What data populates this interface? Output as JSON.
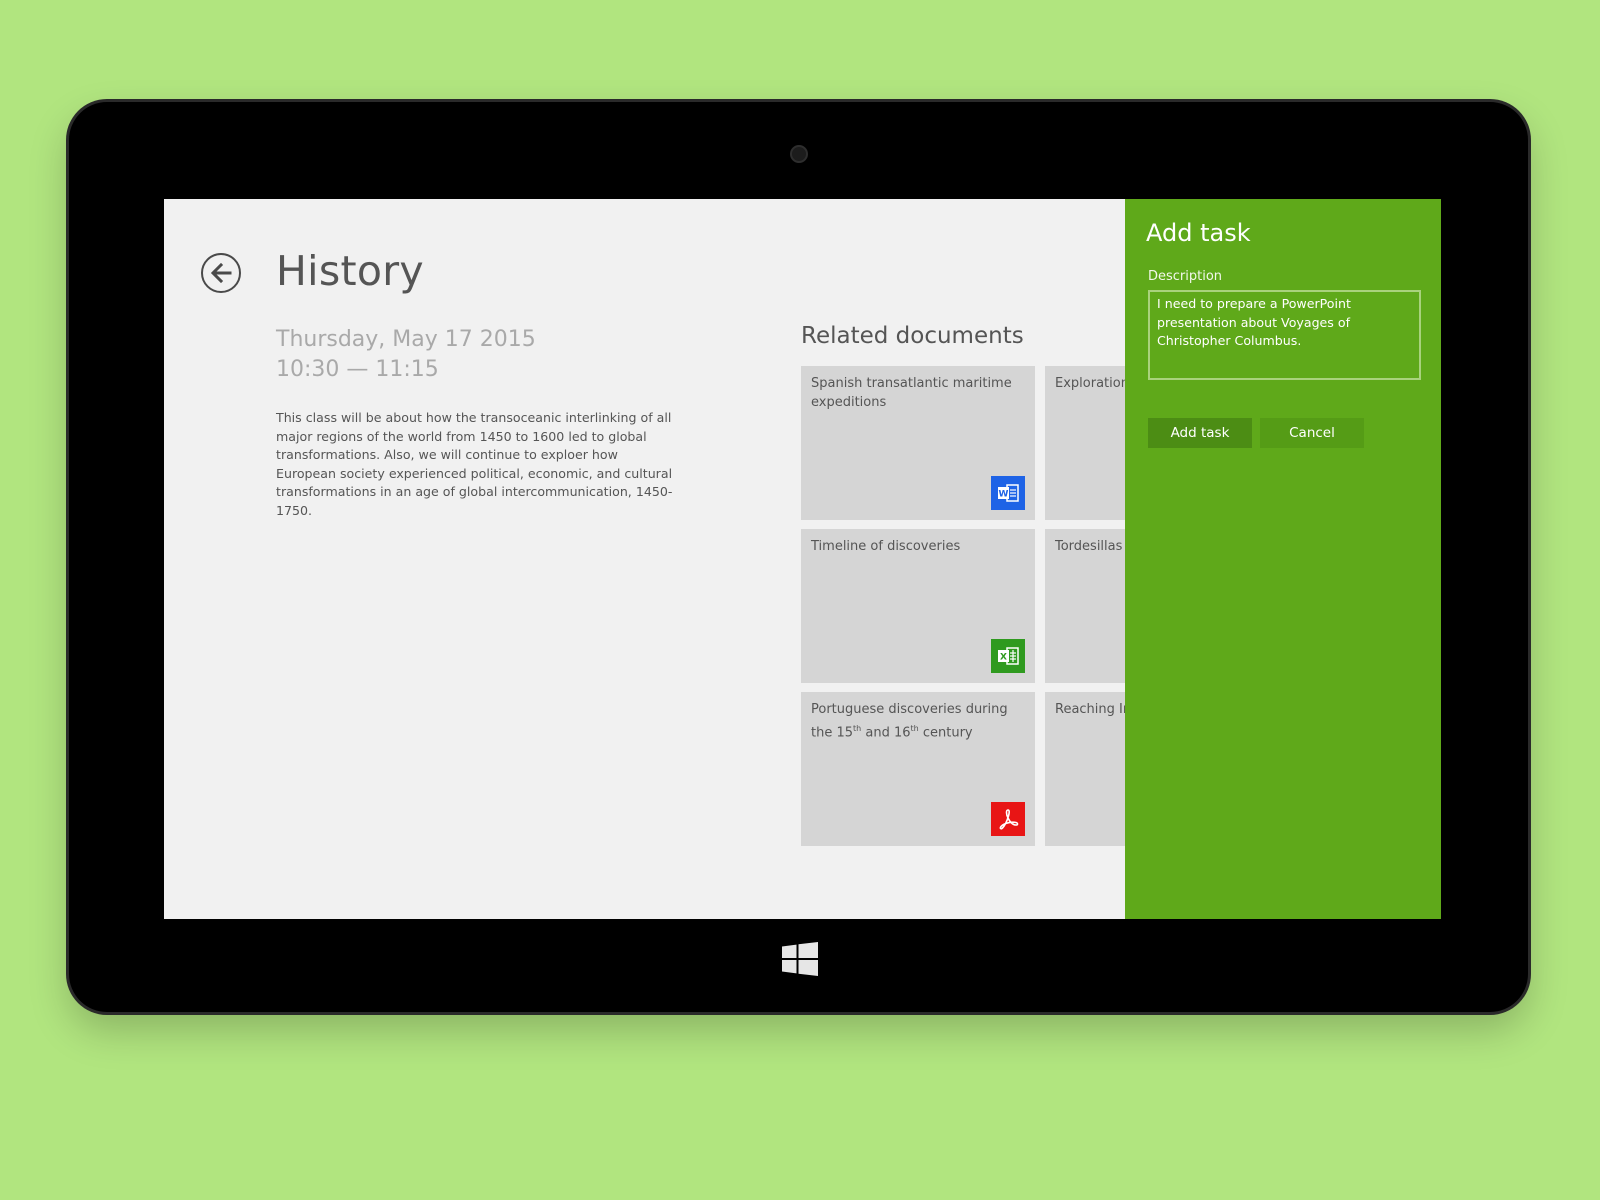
{
  "page": {
    "title": "History",
    "date": "Thursday, May 17 2015",
    "time": "10:30 — 11:15",
    "description": "This class will be about how the transoceanic interlinking of all major regions of the world from 1450 to 1600 led to global transformations. Also, we will continue to exploer how European society experienced political, economic, and cultural transformations in an age of global intercommunication, 1450-1750."
  },
  "related": {
    "title": "Related documents",
    "documents": [
      {
        "title": "Spanish transatlantic maritime expeditions",
        "icon": "word-icon"
      },
      {
        "title": "Exploration",
        "icon": "none"
      },
      {
        "title": "Timeline of discoveries",
        "icon": "excel-icon"
      },
      {
        "title": "Tordesillas",
        "icon": "none"
      },
      {
        "title_prefix": "Portuguese discoveries during the 15",
        "sup1": "th",
        "title_mid": " and 16",
        "sup2": "th",
        "title_suffix": " century",
        "icon": "pdf-icon"
      },
      {
        "title": "Reaching In",
        "icon": "none"
      }
    ]
  },
  "add_task": {
    "title": "Add task",
    "description_label": "Description",
    "description_value": "I need to prepare a PowerPoint presentation about Voyages of Christopher Columbus.",
    "submit_label": "Add task",
    "cancel_label": "Cancel"
  },
  "colors": {
    "background": "#b1e57f",
    "panel": "#5fa91a",
    "word": "#1e63e6",
    "excel": "#2f9a1f",
    "pdf": "#e81515"
  }
}
